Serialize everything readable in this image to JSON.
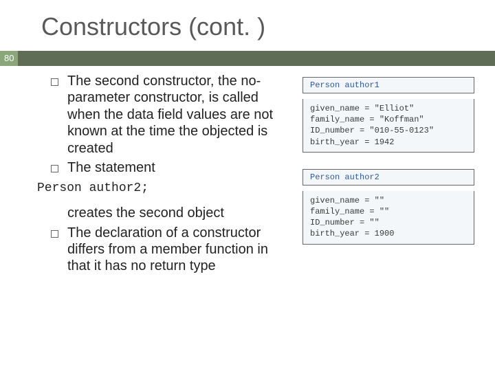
{
  "slideNumber": "80",
  "title": "Constructors (cont. )",
  "bullets": {
    "b1": "The second constructor, the no-parameter constructor, is called when the data field values are not known at the time the objected is created",
    "b2": "The statement",
    "code": "Person author2;",
    "afterCode": "creates the second object",
    "b3": "The declaration of a constructor differs from a member function in that it has no return type"
  },
  "obj1": {
    "label": "Person author1",
    "l1": "given_name = \"Elliot\"",
    "l2": "family_name = \"Koffman\"",
    "l3": "ID_number = \"010-55-0123\"",
    "l4": "birth_year = 1942"
  },
  "obj2": {
    "label": "Person author2",
    "l1": "given_name = \"\"",
    "l2": "family_name = \"\"",
    "l3": "ID_number = \"\"",
    "l4": "birth_year = 1900"
  }
}
